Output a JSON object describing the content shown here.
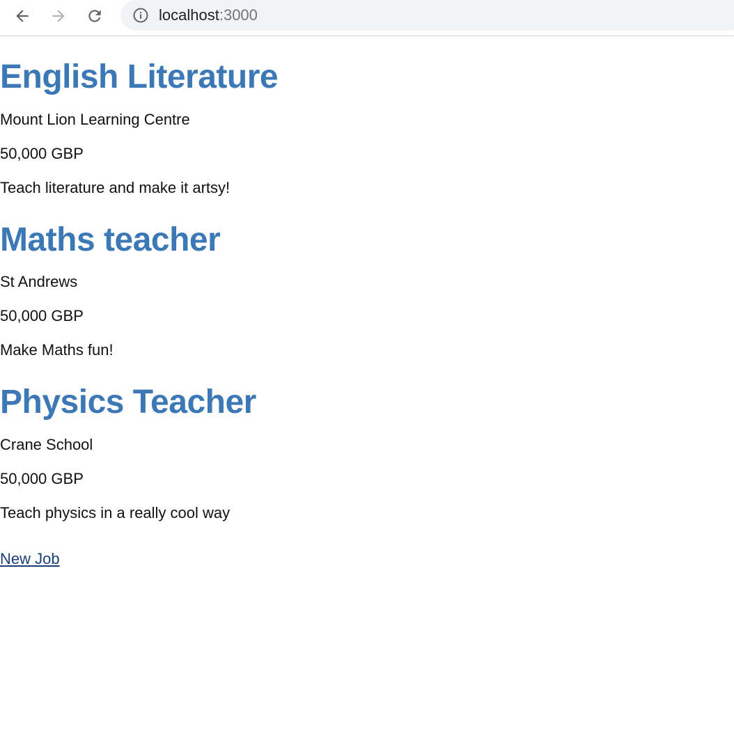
{
  "browser": {
    "url_host": "localhost",
    "url_port": ":3000",
    "icons": {
      "back": "arrow-left-icon",
      "forward": "arrow-right-icon",
      "reload": "reload-icon",
      "info": "info-icon"
    }
  },
  "colors": {
    "title": "#3b78b5",
    "text": "#111111",
    "link": "#1a3f78"
  },
  "jobs": [
    {
      "title": "English Literature",
      "company": "Mount Lion Learning Centre",
      "salary": "50,000 GBP",
      "description": "Teach literature and make it artsy!"
    },
    {
      "title": "Maths teacher",
      "company": "St Andrews",
      "salary": "50,000 GBP",
      "description": "Make Maths fun!"
    },
    {
      "title": "Physics Teacher",
      "company": "Crane School",
      "salary": "50,000 GBP",
      "description": "Teach physics in a really cool way"
    }
  ],
  "new_job_link": "New Job"
}
